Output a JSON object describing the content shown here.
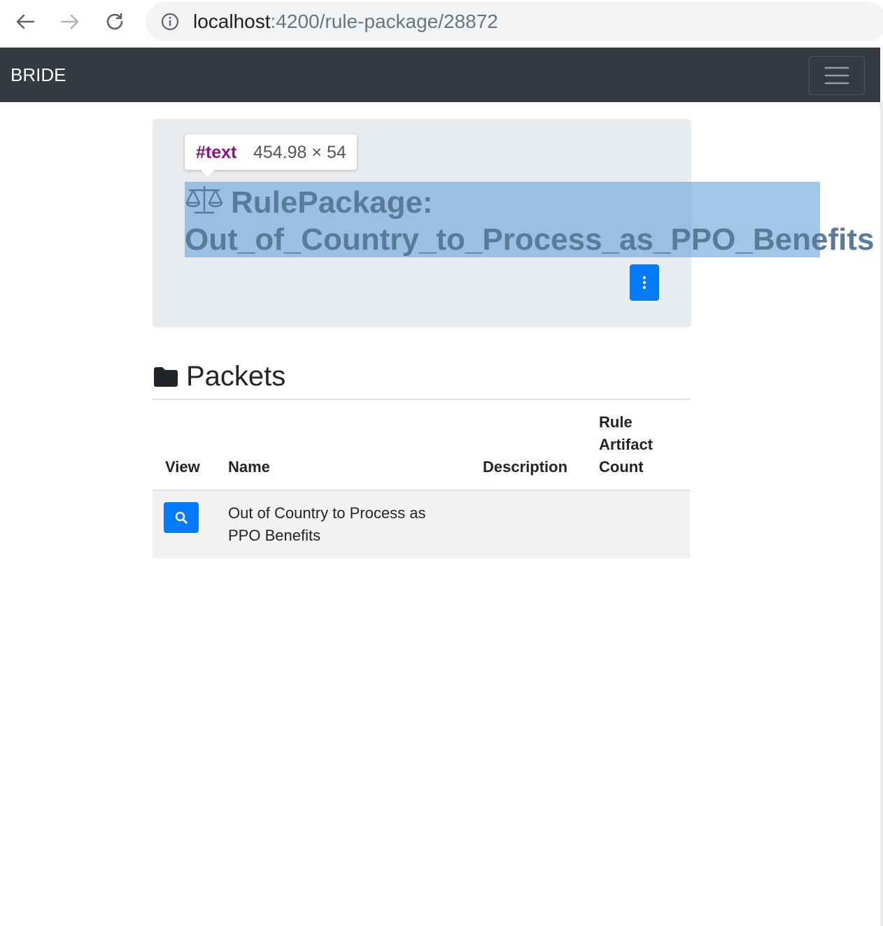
{
  "browser": {
    "url_host": "localhost",
    "url_path": ":4200/rule-package/28872",
    "icons": [
      "back-arrow-icon",
      "forward-arrow-icon",
      "reload-icon",
      "info-icon"
    ]
  },
  "navbar": {
    "brand": "BRIDE",
    "toggler_icon": "hamburger-icon",
    "background": "#343a40"
  },
  "devtools_tooltip": {
    "tag": "#text",
    "size": "454.98 × 54"
  },
  "header": {
    "icon": "balance-scale-icon",
    "title_line1": "RulePackage:",
    "title_line2": "Out_of_Country_to_Process_as_PPO_Benefits",
    "menu_icon": "vertical-ellipsis-icon"
  },
  "packets": {
    "icon": "folder-icon",
    "title": "Packets",
    "columns": {
      "view": "View",
      "name": "Name",
      "description": "Description",
      "rule_artifact_count": "Rule Artifact Count"
    },
    "rows": [
      {
        "view_icon": "search-icon",
        "name": "Out of Country to Process as PPO Benefits",
        "description": "",
        "rule_artifact_count": ""
      }
    ]
  },
  "colors": {
    "primary": "#007bff",
    "jumbotron": "#e9ecef",
    "highlight": "#9fc5e8"
  }
}
